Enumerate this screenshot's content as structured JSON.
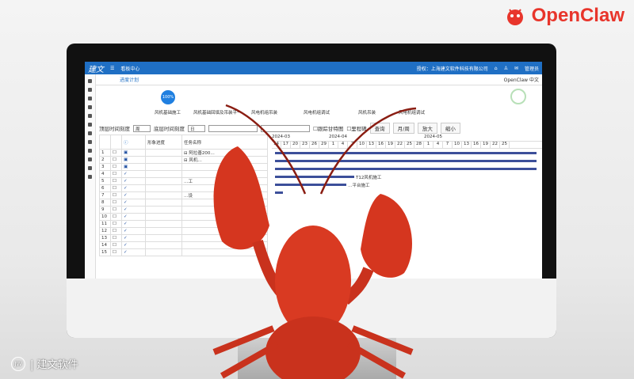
{
  "brand": {
    "name": "OpenClaw"
  },
  "footer": {
    "logo": "JW",
    "label": "| 建文软件"
  },
  "app": {
    "logo": "建文",
    "menu": "看板中心",
    "license": "授权：上海建文软件科技有限公司",
    "user": "管理员",
    "breadcrumb": "进度计划",
    "lang": "OpenClaw 中文"
  },
  "steps": {
    "progress": "100%",
    "items": [
      "风机基础施工",
      "风机基础回填及吊装平一",
      "风电机组吊装",
      "风电机组调试",
      "风机吊装",
      "风电机组调试"
    ]
  },
  "toolbar": {
    "top_scale_label": "顶层时间刻度",
    "top_scale": "周",
    "bottom_scale_label": "底层时间刻度",
    "bottom_scale": "日",
    "track_gantt": "跟踪甘特图",
    "milestone": "里程碑",
    "query": "查询",
    "month_week": "月/周",
    "zoom_in": "放大",
    "zoom_out": "缩小"
  },
  "table": {
    "headers": [
      "",
      "",
      "ⓘ",
      "形象进度",
      "任务名称"
    ],
    "rows": [
      "1",
      "2",
      "3",
      "4",
      "5",
      "6",
      "7",
      "8",
      "9",
      "10",
      "11",
      "12",
      "13",
      "14",
      "15"
    ],
    "tasks": [
      "⊟ 阿拉善200…",
      "⊟ 风机…",
      "",
      "",
      "…工",
      "",
      "…设",
      "",
      "",
      "",
      "",
      "",
      "",
      "",
      ""
    ]
  },
  "gantt": {
    "months": [
      "2024-03",
      "2024-04",
      "2024-05"
    ],
    "days": [
      "14",
      "17",
      "20",
      "23",
      "26",
      "29",
      "1",
      "4",
      "7",
      "10",
      "13",
      "16",
      "19",
      "22",
      "25",
      "28",
      "1",
      "4",
      "7",
      "10",
      "13",
      "16",
      "19",
      "22",
      "25"
    ],
    "labels": [
      "T12风机施工",
      "…平台施工"
    ]
  },
  "colors": {
    "header": "#1f6fc4",
    "bar": "#3c4f9a",
    "brand": "#e8352b"
  }
}
